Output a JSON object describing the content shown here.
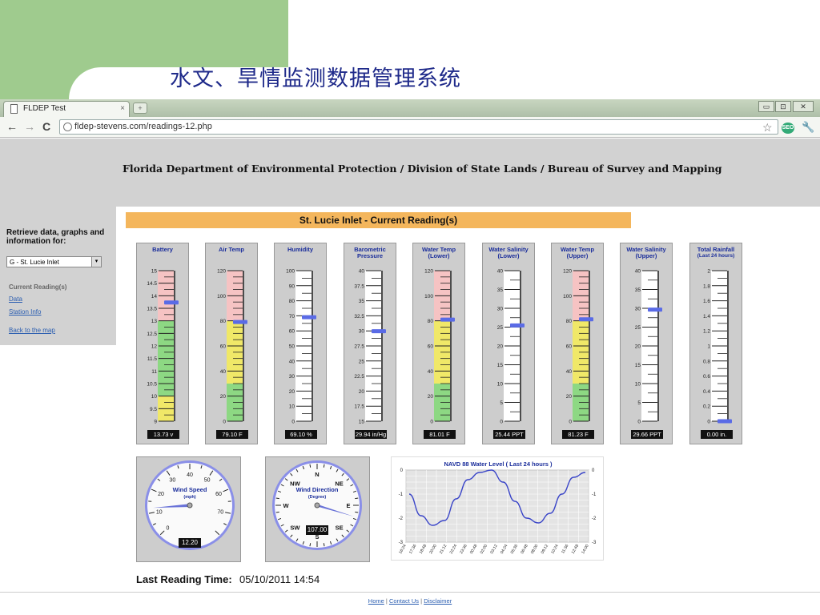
{
  "slide": {
    "title": "水文、旱情监测数据管理系统"
  },
  "browser": {
    "tab_title": "FLDEP Test",
    "tab_close": "×",
    "new_tab": "+",
    "url": "fldep-stevens.com/readings-12.php",
    "back": "←",
    "forward": "→",
    "reload": "C",
    "minimize": "▭",
    "maximize": "⊡",
    "close": "✕",
    "star": "☆",
    "seo": "SEO",
    "wrench": "🔧"
  },
  "page": {
    "org": "Florida Department of Environmental Protection / Division of State Lands / Bureau of Survey and Mapping",
    "sidebar": {
      "retrieve": "Retrieve data, graphs and information for:",
      "selected_station": "G - St. Lucie Inlet",
      "select_arrow": "▾",
      "current_readings": "Current Reading(s)",
      "data_link": "Data",
      "station_info_link": "Station Info",
      "back_link": "Back to the map"
    },
    "section_title": "St. Lucie Inlet - Current Reading(s)",
    "gauges": [
      {
        "title": "Battery",
        "value_text": "13.73 v",
        "min": 9,
        "max": 15,
        "value": 13.73,
        "ticks": [
          "15",
          "14.5",
          "14",
          "13.5",
          "13",
          "12.5",
          "12",
          "11.5",
          "11",
          "10.5",
          "10",
          "9.5",
          "9"
        ],
        "bands": [
          {
            "from": 9,
            "to": 10,
            "color": "#f0e868"
          },
          {
            "from": 10,
            "to": 13,
            "color": "#8dd883"
          },
          {
            "from": 13,
            "to": 15,
            "color": "#f6c3c3"
          }
        ]
      },
      {
        "title": "Air Temp",
        "value_text": "79.10 F",
        "min": 0,
        "max": 120,
        "value": 79.1,
        "ticks": [
          "120",
          "100",
          "80",
          "60",
          "40",
          "20",
          "0"
        ],
        "bands": [
          {
            "from": 0,
            "to": 30,
            "color": "#8dd883"
          },
          {
            "from": 30,
            "to": 80,
            "color": "#f0e868"
          },
          {
            "from": 80,
            "to": 120,
            "color": "#f6c3c3"
          }
        ]
      },
      {
        "title": "Humidity",
        "value_text": "69.10 %",
        "min": 0,
        "max": 100,
        "value": 69.1,
        "ticks": [
          "100",
          "90",
          "80",
          "70",
          "60",
          "50",
          "40",
          "30",
          "20",
          "10",
          "0"
        ],
        "bands": []
      },
      {
        "title": "Barometric Pressure",
        "value_text": "29.94 in/Hg",
        "min": 15,
        "max": 40,
        "value": 29.94,
        "ticks": [
          "40",
          "37.5",
          "35",
          "32.5",
          "30",
          "27.5",
          "25",
          "22.5",
          "20",
          "17.5",
          "15"
        ],
        "bands": []
      },
      {
        "title": "Water Temp (Lower)",
        "value_text": "81.01 F",
        "min": 0,
        "max": 120,
        "value": 81.01,
        "ticks": [
          "120",
          "100",
          "80",
          "60",
          "40",
          "20",
          "0"
        ],
        "bands": [
          {
            "from": 0,
            "to": 30,
            "color": "#8dd883"
          },
          {
            "from": 30,
            "to": 80,
            "color": "#f0e868"
          },
          {
            "from": 80,
            "to": 120,
            "color": "#f6c3c3"
          }
        ]
      },
      {
        "title": "Water Salinity (Lower)",
        "value_text": "25.44 PPT",
        "min": 0,
        "max": 40,
        "value": 25.44,
        "ticks": [
          "40",
          "35",
          "30",
          "25",
          "20",
          "15",
          "10",
          "5",
          "0"
        ],
        "bands": []
      },
      {
        "title": "Water Temp (Upper)",
        "value_text": "81.23 F",
        "min": 0,
        "max": 120,
        "value": 81.23,
        "ticks": [
          "120",
          "100",
          "80",
          "60",
          "40",
          "20",
          "0"
        ],
        "bands": [
          {
            "from": 0,
            "to": 30,
            "color": "#8dd883"
          },
          {
            "from": 30,
            "to": 80,
            "color": "#f0e868"
          },
          {
            "from": 80,
            "to": 120,
            "color": "#f6c3c3"
          }
        ]
      },
      {
        "title": "Water Salinity (Upper)",
        "value_text": "29.66 PPT",
        "min": 0,
        "max": 40,
        "value": 29.66,
        "ticks": [
          "40",
          "35",
          "30",
          "25",
          "20",
          "15",
          "10",
          "5",
          "0"
        ],
        "bands": []
      },
      {
        "title": "Total Rainfall",
        "subtitle": "(Last 24 hours)",
        "value_text": "0.00 in.",
        "min": 0,
        "max": 2,
        "value": 0,
        "ticks": [
          "2",
          "1.8",
          "1.6",
          "1.4",
          "1.2",
          "1",
          "0.8",
          "0.6",
          "0.4",
          "0.2",
          "0"
        ],
        "bands": []
      }
    ],
    "wind_speed": {
      "title": "Wind Speed",
      "unit": "(mph)",
      "value_text": "12.20",
      "value": 12.2,
      "labels": [
        "0",
        "10",
        "20",
        "30",
        "40",
        "50",
        "60",
        "70"
      ]
    },
    "wind_direction": {
      "title": "Wind Direction",
      "unit": "(Degree)",
      "value_text": "107.00",
      "value": 107,
      "labels": {
        "N": "N",
        "NE": "NE",
        "E": "E",
        "SE": "SE",
        "S": "S",
        "SW": "SW",
        "W": "W",
        "NW": "NW"
      }
    },
    "chart_data": {
      "type": "line",
      "title": "NAVD 88 Water Level ( Last 24 hours )",
      "x": [
        "16:24",
        "17:36",
        "18:48",
        "20:00",
        "21:12",
        "22:24",
        "23:36",
        "00:48",
        "02:00",
        "03:12",
        "04:24",
        "05:36",
        "06:48",
        "08:00",
        "09:12",
        "10:24",
        "11:36",
        "12:48",
        "14:00"
      ],
      "y": [
        -1.0,
        -1.9,
        -2.3,
        -2.1,
        -1.2,
        -0.4,
        -0.1,
        0.0,
        -0.5,
        -1.3,
        -2.0,
        -2.2,
        -1.8,
        -1.0,
        -0.3,
        -0.1
      ],
      "yticks": [
        "0",
        "-1",
        "-2",
        "-3"
      ],
      "ylim": [
        -3,
        0
      ],
      "grid": true,
      "color": "#3a45c8"
    },
    "last_reading_label": "Last Reading Time:",
    "last_reading_value": "05/10/2011 14:54",
    "footer": {
      "home": "Home",
      "contact": "Contact Us",
      "disclaimer": "Disclaimer",
      "sep": "|"
    }
  }
}
